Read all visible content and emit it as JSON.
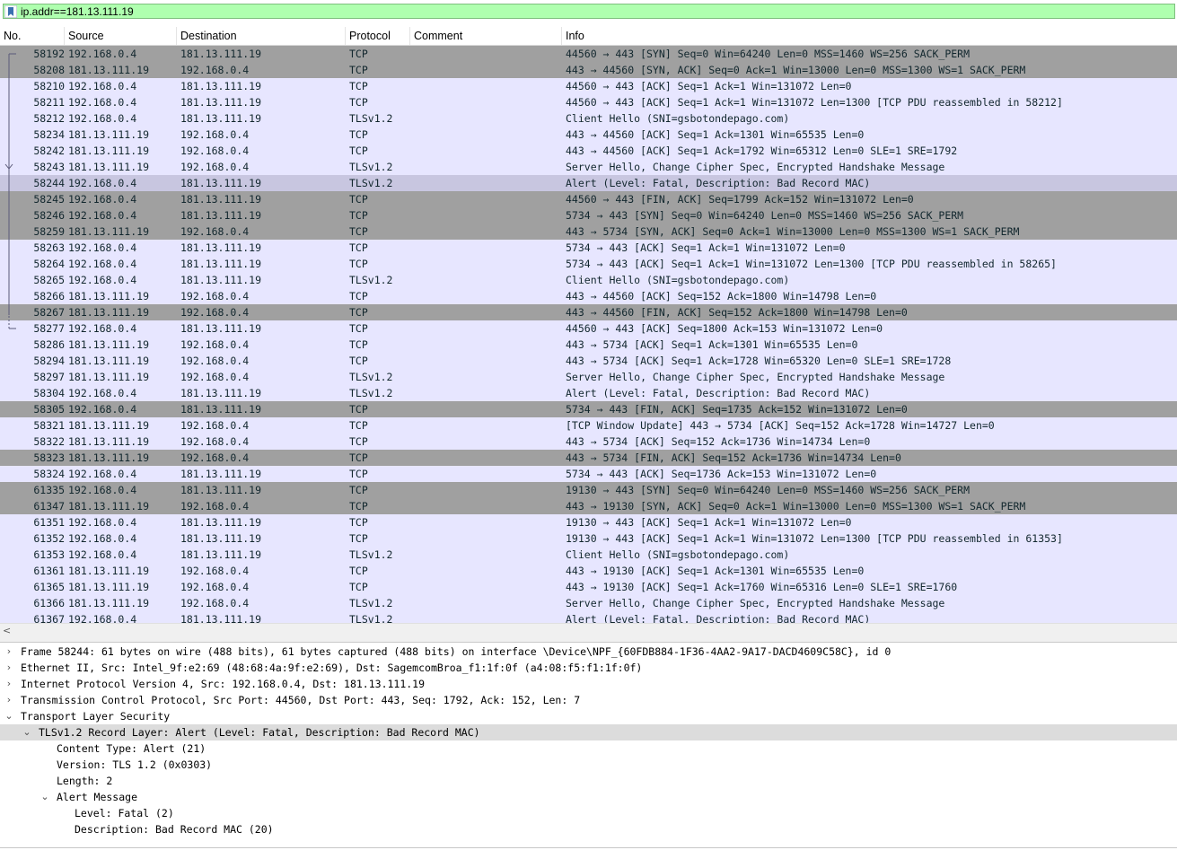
{
  "filter": {
    "value": "ip.addr==181.13.111.19"
  },
  "columns": [
    "No.",
    "Source",
    "Destination",
    "Protocol",
    "Comment",
    "Info"
  ],
  "packets": [
    {
      "no": "58192",
      "src": "192.168.0.4",
      "dst": "181.13.111.19",
      "proto": "TCP",
      "comment": "",
      "info": "44560 → 443 [SYN] Seq=0 Win=64240 Len=0 MSS=1460 WS=256 SACK_PERM",
      "style": "syn"
    },
    {
      "no": "58208",
      "src": "181.13.111.19",
      "dst": "192.168.0.4",
      "proto": "TCP",
      "comment": "",
      "info": "443 → 44560 [SYN, ACK] Seq=0 Ack=1 Win=13000 Len=0 MSS=1300 WS=1 SACK_PERM",
      "style": "syn"
    },
    {
      "no": "58210",
      "src": "192.168.0.4",
      "dst": "181.13.111.19",
      "proto": "TCP",
      "comment": "",
      "info": "44560 → 443 [ACK] Seq=1 Ack=1 Win=131072 Len=0",
      "style": "normal"
    },
    {
      "no": "58211",
      "src": "192.168.0.4",
      "dst": "181.13.111.19",
      "proto": "TCP",
      "comment": "",
      "info": "44560 → 443 [ACK] Seq=1 Ack=1 Win=131072 Len=1300 [TCP PDU reassembled in 58212]",
      "style": "normal"
    },
    {
      "no": "58212",
      "src": "192.168.0.4",
      "dst": "181.13.111.19",
      "proto": "TLSv1.2",
      "comment": "",
      "info": "Client Hello (SNI=gsbotondepago.com)",
      "style": "normal"
    },
    {
      "no": "58234",
      "src": "181.13.111.19",
      "dst": "192.168.0.4",
      "proto": "TCP",
      "comment": "",
      "info": "443 → 44560 [ACK] Seq=1 Ack=1301 Win=65535 Len=0",
      "style": "normal"
    },
    {
      "no": "58242",
      "src": "181.13.111.19",
      "dst": "192.168.0.4",
      "proto": "TCP",
      "comment": "",
      "info": "443 → 44560 [ACK] Seq=1 Ack=1792 Win=65312 Len=0 SLE=1 SRE=1792",
      "style": "normal"
    },
    {
      "no": "58243",
      "src": "181.13.111.19",
      "dst": "192.168.0.4",
      "proto": "TLSv1.2",
      "comment": "",
      "info": "Server Hello, Change Cipher Spec, Encrypted Handshake Message",
      "style": "normal"
    },
    {
      "no": "58244",
      "src": "192.168.0.4",
      "dst": "181.13.111.19",
      "proto": "TLSv1.2",
      "comment": "",
      "info": "Alert (Level: Fatal, Description: Bad Record MAC)",
      "style": "sel"
    },
    {
      "no": "58245",
      "src": "192.168.0.4",
      "dst": "181.13.111.19",
      "proto": "TCP",
      "comment": "",
      "info": "44560 → 443 [FIN, ACK] Seq=1799 Ack=152 Win=131072 Len=0",
      "style": "syn"
    },
    {
      "no": "58246",
      "src": "192.168.0.4",
      "dst": "181.13.111.19",
      "proto": "TCP",
      "comment": "",
      "info": "5734 → 443 [SYN] Seq=0 Win=64240 Len=0 MSS=1460 WS=256 SACK_PERM",
      "style": "syn"
    },
    {
      "no": "58259",
      "src": "181.13.111.19",
      "dst": "192.168.0.4",
      "proto": "TCP",
      "comment": "",
      "info": "443 → 5734 [SYN, ACK] Seq=0 Ack=1 Win=13000 Len=0 MSS=1300 WS=1 SACK_PERM",
      "style": "syn"
    },
    {
      "no": "58263",
      "src": "192.168.0.4",
      "dst": "181.13.111.19",
      "proto": "TCP",
      "comment": "",
      "info": "5734 → 443 [ACK] Seq=1 Ack=1 Win=131072 Len=0",
      "style": "normal"
    },
    {
      "no": "58264",
      "src": "192.168.0.4",
      "dst": "181.13.111.19",
      "proto": "TCP",
      "comment": "",
      "info": "5734 → 443 [ACK] Seq=1 Ack=1 Win=131072 Len=1300 [TCP PDU reassembled in 58265]",
      "style": "normal"
    },
    {
      "no": "58265",
      "src": "192.168.0.4",
      "dst": "181.13.111.19",
      "proto": "TLSv1.2",
      "comment": "",
      "info": "Client Hello (SNI=gsbotondepago.com)",
      "style": "normal"
    },
    {
      "no": "58266",
      "src": "181.13.111.19",
      "dst": "192.168.0.4",
      "proto": "TCP",
      "comment": "",
      "info": "443 → 44560 [ACK] Seq=152 Ack=1800 Win=14798 Len=0",
      "style": "normal"
    },
    {
      "no": "58267",
      "src": "181.13.111.19",
      "dst": "192.168.0.4",
      "proto": "TCP",
      "comment": "",
      "info": "443 → 44560 [FIN, ACK] Seq=152 Ack=1800 Win=14798 Len=0",
      "style": "syn"
    },
    {
      "no": "58277",
      "src": "192.168.0.4",
      "dst": "181.13.111.19",
      "proto": "TCP",
      "comment": "",
      "info": "44560 → 443 [ACK] Seq=1800 Ack=153 Win=131072 Len=0",
      "style": "normal"
    },
    {
      "no": "58286",
      "src": "181.13.111.19",
      "dst": "192.168.0.4",
      "proto": "TCP",
      "comment": "",
      "info": "443 → 5734 [ACK] Seq=1 Ack=1301 Win=65535 Len=0",
      "style": "normal"
    },
    {
      "no": "58294",
      "src": "181.13.111.19",
      "dst": "192.168.0.4",
      "proto": "TCP",
      "comment": "",
      "info": "443 → 5734 [ACK] Seq=1 Ack=1728 Win=65320 Len=0 SLE=1 SRE=1728",
      "style": "normal"
    },
    {
      "no": "58297",
      "src": "181.13.111.19",
      "dst": "192.168.0.4",
      "proto": "TLSv1.2",
      "comment": "",
      "info": "Server Hello, Change Cipher Spec, Encrypted Handshake Message",
      "style": "normal"
    },
    {
      "no": "58304",
      "src": "192.168.0.4",
      "dst": "181.13.111.19",
      "proto": "TLSv1.2",
      "comment": "",
      "info": "Alert (Level: Fatal, Description: Bad Record MAC)",
      "style": "normal"
    },
    {
      "no": "58305",
      "src": "192.168.0.4",
      "dst": "181.13.111.19",
      "proto": "TCP",
      "comment": "",
      "info": "5734 → 443 [FIN, ACK] Seq=1735 Ack=152 Win=131072 Len=0",
      "style": "syn"
    },
    {
      "no": "58321",
      "src": "181.13.111.19",
      "dst": "192.168.0.4",
      "proto": "TCP",
      "comment": "",
      "info": "[TCP Window Update] 443 → 5734 [ACK] Seq=152 Ack=1728 Win=14727 Len=0",
      "style": "normal"
    },
    {
      "no": "58322",
      "src": "181.13.111.19",
      "dst": "192.168.0.4",
      "proto": "TCP",
      "comment": "",
      "info": "443 → 5734 [ACK] Seq=152 Ack=1736 Win=14734 Len=0",
      "style": "normal"
    },
    {
      "no": "58323",
      "src": "181.13.111.19",
      "dst": "192.168.0.4",
      "proto": "TCP",
      "comment": "",
      "info": "443 → 5734 [FIN, ACK] Seq=152 Ack=1736 Win=14734 Len=0",
      "style": "syn"
    },
    {
      "no": "58324",
      "src": "192.168.0.4",
      "dst": "181.13.111.19",
      "proto": "TCP",
      "comment": "",
      "info": "5734 → 443 [ACK] Seq=1736 Ack=153 Win=131072 Len=0",
      "style": "normal"
    },
    {
      "no": "61335",
      "src": "192.168.0.4",
      "dst": "181.13.111.19",
      "proto": "TCP",
      "comment": "",
      "info": "19130 → 443 [SYN] Seq=0 Win=64240 Len=0 MSS=1460 WS=256 SACK_PERM",
      "style": "syn"
    },
    {
      "no": "61347",
      "src": "181.13.111.19",
      "dst": "192.168.0.4",
      "proto": "TCP",
      "comment": "",
      "info": "443 → 19130 [SYN, ACK] Seq=0 Ack=1 Win=13000 Len=0 MSS=1300 WS=1 SACK_PERM",
      "style": "syn"
    },
    {
      "no": "61351",
      "src": "192.168.0.4",
      "dst": "181.13.111.19",
      "proto": "TCP",
      "comment": "",
      "info": "19130 → 443 [ACK] Seq=1 Ack=1 Win=131072 Len=0",
      "style": "normal"
    },
    {
      "no": "61352",
      "src": "192.168.0.4",
      "dst": "181.13.111.19",
      "proto": "TCP",
      "comment": "",
      "info": "19130 → 443 [ACK] Seq=1 Ack=1 Win=131072 Len=1300 [TCP PDU reassembled in 61353]",
      "style": "normal"
    },
    {
      "no": "61353",
      "src": "192.168.0.4",
      "dst": "181.13.111.19",
      "proto": "TLSv1.2",
      "comment": "",
      "info": "Client Hello (SNI=gsbotondepago.com)",
      "style": "normal"
    },
    {
      "no": "61361",
      "src": "181.13.111.19",
      "dst": "192.168.0.4",
      "proto": "TCP",
      "comment": "",
      "info": "443 → 19130 [ACK] Seq=1 Ack=1301 Win=65535 Len=0",
      "style": "normal"
    },
    {
      "no": "61365",
      "src": "181.13.111.19",
      "dst": "192.168.0.4",
      "proto": "TCP",
      "comment": "",
      "info": "443 → 19130 [ACK] Seq=1 Ack=1760 Win=65316 Len=0 SLE=1 SRE=1760",
      "style": "normal"
    },
    {
      "no": "61366",
      "src": "181.13.111.19",
      "dst": "192.168.0.4",
      "proto": "TLSv1.2",
      "comment": "",
      "info": "Server Hello, Change Cipher Spec, Encrypted Handshake Message",
      "style": "normal"
    },
    {
      "no": "61367",
      "src": "192.168.0.4",
      "dst": "181.13.111.19",
      "proto": "TLSv1.2",
      "comment": "",
      "info": "Alert (Level: Fatal, Description: Bad Record MAC)",
      "style": "normal"
    }
  ],
  "details": [
    {
      "level": 0,
      "expander": "collapsed",
      "text": "Frame 58244: 61 bytes on wire (488 bits), 61 bytes captured (488 bits) on interface \\Device\\NPF_{60FDB884-1F36-4AA2-9A17-DACD4609C58C}, id 0",
      "selected": false
    },
    {
      "level": 0,
      "expander": "collapsed",
      "text": "Ethernet II, Src: Intel_9f:e2:69 (48:68:4a:9f:e2:69), Dst: SagemcomBroa_f1:1f:0f (a4:08:f5:f1:1f:0f)",
      "selected": false
    },
    {
      "level": 0,
      "expander": "collapsed",
      "text": "Internet Protocol Version 4, Src: 192.168.0.4, Dst: 181.13.111.19",
      "selected": false
    },
    {
      "level": 0,
      "expander": "collapsed",
      "text": "Transmission Control Protocol, Src Port: 44560, Dst Port: 443, Seq: 1792, Ack: 152, Len: 7",
      "selected": false
    },
    {
      "level": 0,
      "expander": "expanded",
      "text": "Transport Layer Security",
      "selected": false
    },
    {
      "level": 1,
      "expander": "expanded",
      "text": "TLSv1.2 Record Layer: Alert (Level: Fatal, Description: Bad Record MAC)",
      "selected": true
    },
    {
      "level": 2,
      "expander": "none",
      "text": "Content Type: Alert (21)",
      "selected": false
    },
    {
      "level": 2,
      "expander": "none",
      "text": "Version: TLS 1.2 (0x0303)",
      "selected": false
    },
    {
      "level": 2,
      "expander": "none",
      "text": "Length: 2",
      "selected": false
    },
    {
      "level": 2,
      "expander": "expanded",
      "text": "Alert Message",
      "selected": false
    },
    {
      "level": 3,
      "expander": "none",
      "text": "Level: Fatal (2)",
      "selected": false
    },
    {
      "level": 3,
      "expander": "none",
      "text": "Description: Bad Record MAC (20)",
      "selected": false
    }
  ],
  "icons": {
    "bookmark": "bookmark-icon",
    "expander_collapsed": "›",
    "expander_expanded": "⌄",
    "scroll_left": "<"
  },
  "colors": {
    "filter_valid": "#afffaf",
    "row_tcp_normal": "#e7e6ff",
    "row_syn_fin": "#a0a0a0",
    "row_selected": "#c8c6e0"
  }
}
